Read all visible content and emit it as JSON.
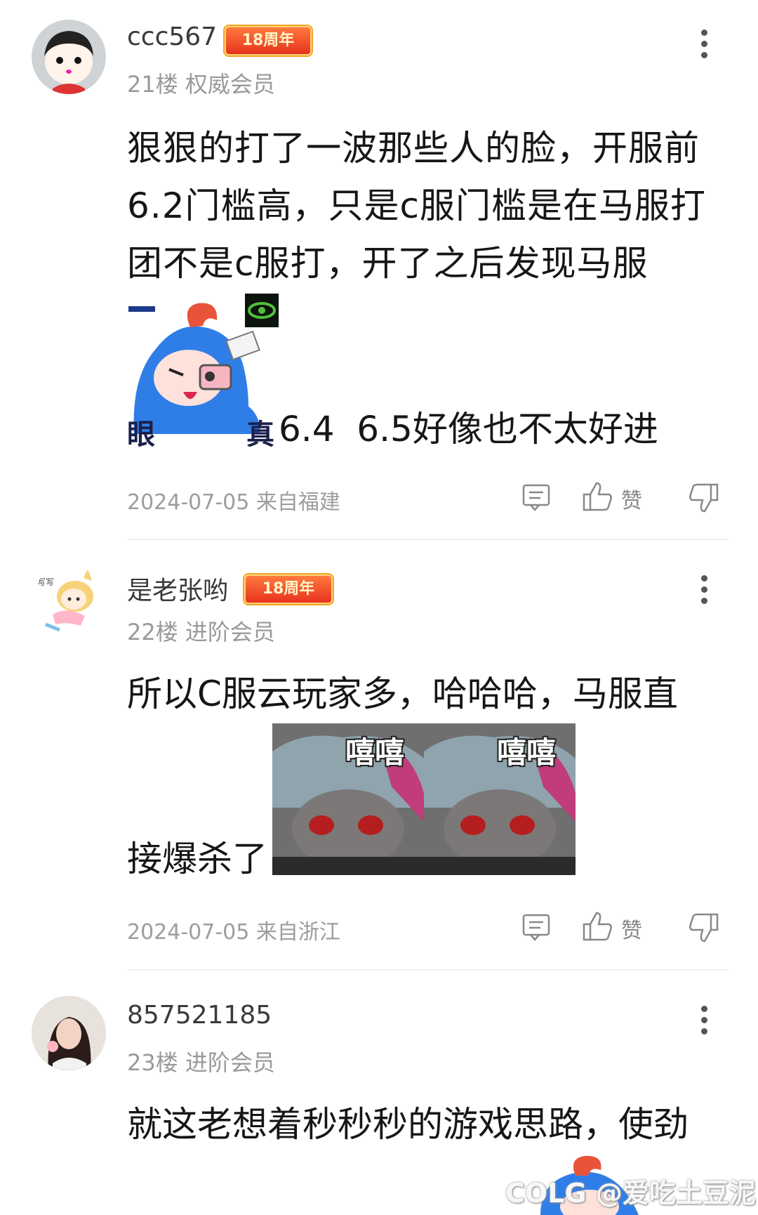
{
  "comments": [
    {
      "username": "ccc567",
      "badge": "18周年",
      "floor": "21楼",
      "rank": "权威会员",
      "text_line1": "狠狠的打了一波那些人的脸，开服前",
      "text_line2": "6.2门槛高，只是c服门槛是在马服打",
      "text_line3": "团不是c服打，开了之后发现马服",
      "sticker_text_left": "眼",
      "sticker_text_right": "真",
      "text_after_sticker": "6.4  6.5好像也不太好进",
      "date": "2024-07-05",
      "location": "来自福建",
      "like_label": "赞"
    },
    {
      "username": "是老张哟",
      "badge": "18周年",
      "floor": "22楼",
      "rank": "进阶会员",
      "text_line1": "所以C服云玩家多，哈哈哈，马服直",
      "text_line2": "接爆杀了",
      "sticker_caption": "嘻嘻",
      "date": "2024-07-05",
      "location": "来自浙江",
      "like_label": "赞"
    },
    {
      "username": "857521185",
      "floor": "23楼",
      "rank": "进阶会员",
      "text_line1": "就这老想着秒秒秒的游戏思路，使劲"
    }
  ],
  "watermark": "COLG @爱吃土豆泥",
  "colors": {
    "badge_bg": "#e8321f",
    "sticker_blue": "#2f7ee8",
    "meta_gray": "#9d9d9d"
  }
}
